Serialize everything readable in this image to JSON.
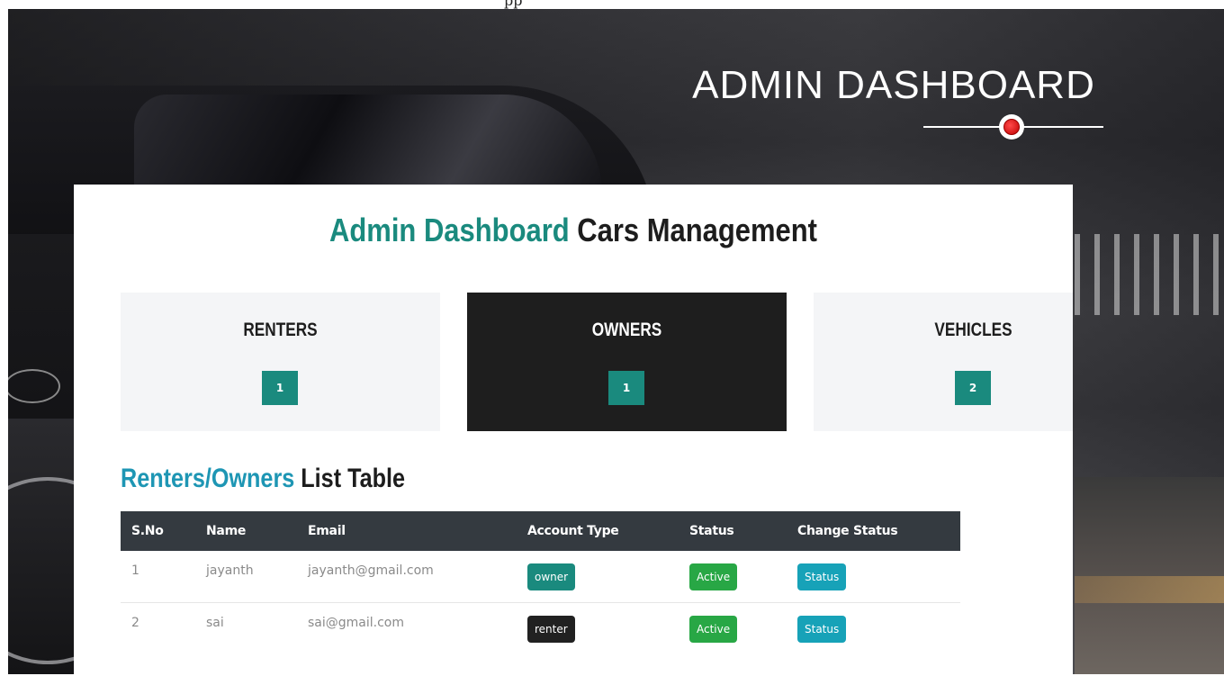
{
  "top_text": "pp",
  "hero": {
    "title": "ADMIN DASHBOARD"
  },
  "panel": {
    "title_accent": "Admin Dashboard",
    "title_rest": "Cars Management"
  },
  "stats": [
    {
      "label": "RENTERS",
      "value": "1"
    },
    {
      "label": "OWNERS",
      "value": "1"
    },
    {
      "label": "VEHICLES",
      "value": "2"
    }
  ],
  "table": {
    "heading_accent": "Renters/Owners",
    "heading_rest": "List Table",
    "columns": [
      "S.No",
      "Name",
      "Email",
      "Account Type",
      "Status",
      "Change Status"
    ],
    "rows": [
      {
        "sno": "1",
        "name": "jayanth",
        "email": "jayanth@gmail.com",
        "account_type": "owner",
        "status": "Active",
        "action": "Status"
      },
      {
        "sno": "2",
        "name": "sai",
        "email": "sai@gmail.com",
        "account_type": "renter",
        "status": "Active",
        "action": "Status"
      }
    ]
  },
  "colors": {
    "accent_teal": "#1a8a7e",
    "accent_blue": "#1e96b4",
    "table_header": "#343a40",
    "success": "#28a745",
    "info": "#17a2b8",
    "divider_dot": "#d40000"
  },
  "icons": {
    "divider": "red-dot-icon"
  }
}
